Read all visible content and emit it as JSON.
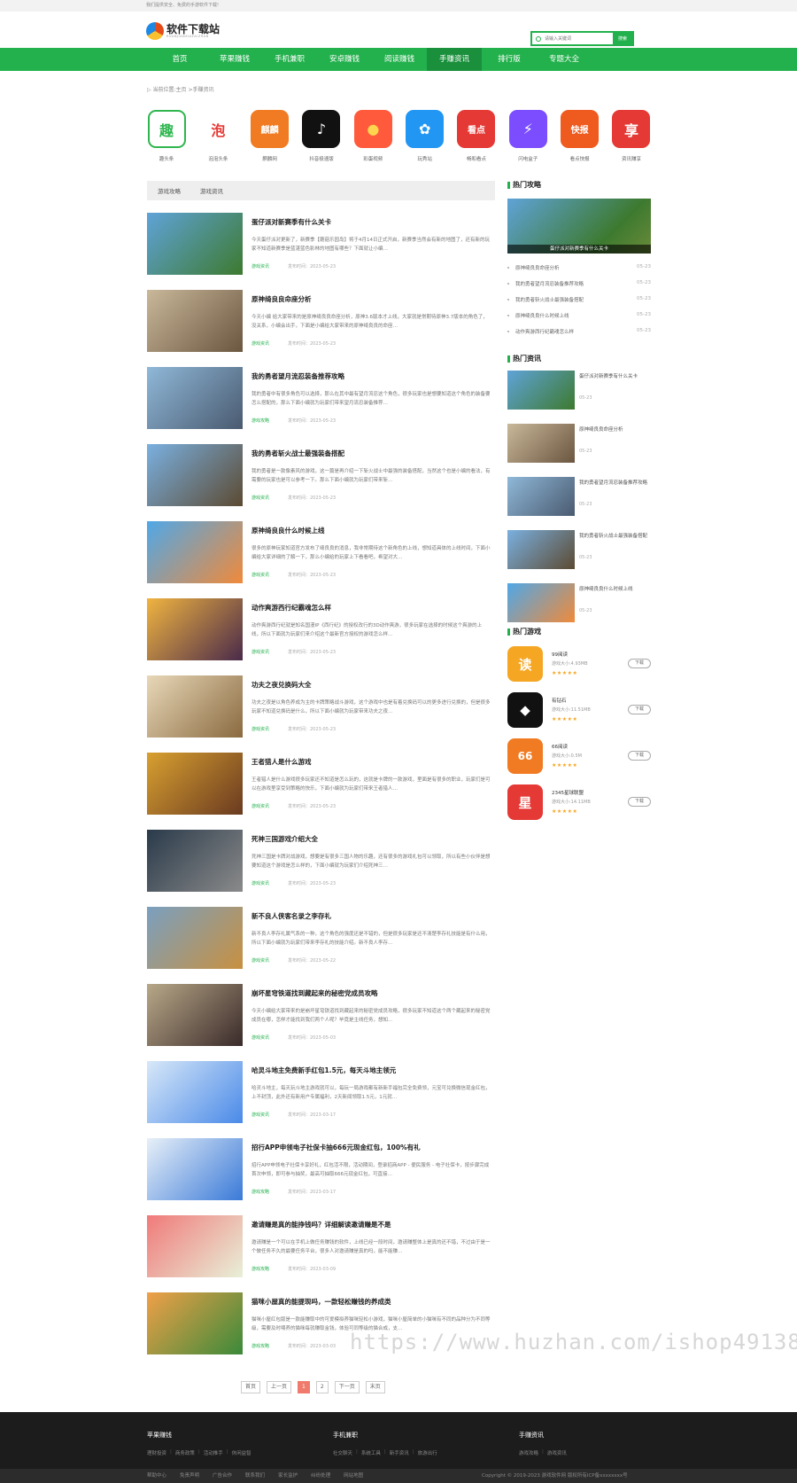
{
  "topbar": {
    "text": "我们提供安全、免费的手游软件下载!"
  },
  "logo": {
    "title": "软件下载站",
    "sub": "RUANJIANXIAZAIZHAN"
  },
  "search": {
    "placeholder": "请输入关键词",
    "button": "搜索"
  },
  "nav": [
    {
      "label": "首页",
      "active": false
    },
    {
      "label": "苹果赚钱",
      "active": false
    },
    {
      "label": "手机兼职",
      "active": false
    },
    {
      "label": "安卓赚钱",
      "active": false
    },
    {
      "label": "阅读赚钱",
      "active": false
    },
    {
      "label": "手赚资讯",
      "active": true
    },
    {
      "label": "排行版",
      "active": false
    },
    {
      "label": "专题大全",
      "active": false
    }
  ],
  "breadcrumb": "当前位置:主页 >手赚资讯",
  "apps": [
    {
      "name": "趣头条",
      "glyph": "趣",
      "color": "#2fb64f",
      "bg": "#fff",
      "border": "#2fb64f"
    },
    {
      "name": "泡泡头条",
      "glyph": "泡",
      "color": "#e53935",
      "bg": "#fff",
      "border": "#fff"
    },
    {
      "name": "麒麟网",
      "glyph": "麒麟",
      "color": "#fff",
      "bg": "#f07b22",
      "border": "#f07b22"
    },
    {
      "name": "抖音极速版",
      "glyph": "♪",
      "color": "#fff",
      "bg": "#111",
      "border": "#111"
    },
    {
      "name": "彩蛋视频",
      "glyph": "●",
      "color": "#ffd54f",
      "bg": "#ff5a3c",
      "border": "#ff5a3c"
    },
    {
      "name": "玩秀站",
      "glyph": "✿",
      "color": "#fff",
      "bg": "#2196f3",
      "border": "#2196f3"
    },
    {
      "name": "畅和看点",
      "glyph": "看点",
      "color": "#fff",
      "bg": "#e53935",
      "border": "#e53935"
    },
    {
      "name": "闪电盒子",
      "glyph": "⚡",
      "color": "#fff",
      "bg": "#7c4dff",
      "border": "#7c4dff"
    },
    {
      "name": "看点快报",
      "glyph": "快报",
      "color": "#fff",
      "bg": "#ef5a1e",
      "border": "#ef5a1e"
    },
    {
      "name": "资讯赚享",
      "glyph": "享",
      "color": "#fff",
      "bg": "#e53935",
      "border": "#e53935"
    }
  ],
  "tabs": [
    "游戏攻略",
    "游戏资讯"
  ],
  "articles": [
    {
      "title": "蛋仔派对新赛季有什么关卡",
      "desc": "今天蛋仔派对更新了，新赛季【蘑菇乐园岛】将于4月14日正式开启，新赛季当然会有新的地图了，还有新的玩家不知道新赛季是蓝湛蓝色影林的地图有哪些？下面就让小编…",
      "cat": "游戏资讯",
      "date": "发布时间：2023-05-23",
      "thumb": [
        "#5fa3d8",
        "#3d7a2f"
      ]
    },
    {
      "title": "原神绮良良命座分析",
      "desc": "今天小编 给大家带来的是原神绮良良命座分析，原神3.6版本才上线，大家就是常期待原神3.7版本的角色了，没关系，小编会出手，下面是小编给大家带来的原神绮良良的命座…",
      "cat": "游戏资讯",
      "date": "发布时间：2023-05-23",
      "thumb": [
        "#c9b89a",
        "#6b5640"
      ]
    },
    {
      "title": "我的勇者望月流忍装备推荐攻略",
      "desc": "我的勇者中有很多角色可以选择，那么在其中最有望月流忍这个角色，很多玩家也是想要知道这个角色的装备要怎么搭配的，那么下面小编就为玩家们带来望月流忍装备推荐…",
      "cat": "游戏攻略",
      "date": "发布时间：2023-05-23",
      "thumb": [
        "#8fb8d8",
        "#4a5a70"
      ]
    },
    {
      "title": "我的勇者斩火战士最强装备搭配",
      "desc": "我的勇者是一款像素风的游戏，这一篇是再介绍一下斩火战士中最强的装备搭配，当然这个也是小编的看法，有需要的玩家也是可以参考一下。那么下面小编就为玩家们带来斩…",
      "cat": "游戏资讯",
      "date": "发布时间：2023-05-23",
      "thumb": [
        "#7ab0e0",
        "#5c4a32"
      ]
    },
    {
      "title": "原神绮良良什么时候上线",
      "desc": "很多的原神玩家知道官方发布了绮良良的消息，我非常期待这个新角色的上线，想知道具体的上线时间，下面小编给大家详细的了解一下，那么小编给的玩家上下看看吧，希望对大…",
      "cat": "游戏资讯",
      "date": "发布时间：2023-05-23",
      "thumb": [
        "#4fa8e8",
        "#f08a3a"
      ]
    },
    {
      "title": "动作爽游西行纪霸魂怎么样",
      "desc": "动作爽游西行纪就是知名国漫IP《西行纪》的授权改行的3D动作爽游，很多玩家在选择的时候这个爽游的上线，所以下面就为玩家们来介绍这个最新官方授权的游戏怎么样…",
      "cat": "游戏资讯",
      "date": "发布时间：2023-05-23",
      "thumb": [
        "#f0b440",
        "#4a2a4a"
      ]
    },
    {
      "title": "功夫之夜兑换码大全",
      "desc": "功夫之夜是以角色养成为主的卡牌策略战斗游戏，这个游戏中也是有着兑换码可以的更多进行兑换的，但是很多玩家不知道兑换码是什么，所以下面小编就为玩家带来功夫之夜…",
      "cat": "游戏资讯",
      "date": "发布时间：2023-05-23",
      "thumb": [
        "#e8d8b8",
        "#8a6a40"
      ]
    },
    {
      "title": "王者猎人是什么游戏",
      "desc": "王者猎人是什么游戏很多玩家还不知道是怎么玩的，这就是卡牌的一款游戏，里面是有很多的职业，玩家们是可以在游戏里享受到策略的快乐，下面小编就为玩家们带来王者猎人…",
      "cat": "游戏资讯",
      "date": "发布时间：2023-05-23",
      "thumb": [
        "#d8a030",
        "#6a3a20"
      ]
    },
    {
      "title": "死神三国游戏介绍大全",
      "desc": "死神三国是卡牌对战游戏，想要是有很多三国人物的乐趣，还有很多的游戏礼包可以领取，所以有些小伙伴是想要知道这个游戏是怎么样的，下面小编就为玩家们介绍死神三…",
      "cat": "游戏资讯",
      "date": "发布时间：2023-05-23",
      "thumb": [
        "#2a3a4a",
        "#8a8a8a"
      ]
    },
    {
      "title": "新不良人侠客名录之李存礼",
      "desc": "新不良人李存礼属气系的一种，这个角色的强度还是不错的，但是很多玩家是还不清楚李存礼技能是有什么用，所以下面小编就为玩家们带来李存礼的技能介绍。新不良人李存…",
      "cat": "游戏资讯",
      "date": "发布时间：2023-05-22",
      "thumb": [
        "#7aa0c0",
        "#c89040"
      ]
    },
    {
      "title": "崩坏星穹铁道找到藏起来的秘密党成员攻略",
      "desc": "今天小编给大家带来的是崩坏星穹铁道找到藏起来的秘密党成员攻略，很多玩家不知道这个两个藏起来的秘密党成员在哪，怎样才能找到我们两个人呢？毕竟是主线任务，想知…",
      "cat": "游戏资讯",
      "date": "发布时间：2023-05-03",
      "thumb": [
        "#b8a888",
        "#3a2a2a"
      ]
    },
    {
      "title": "哈灵斗地主免费新手红包1.5元，每天斗地主领元",
      "desc": "哈灵斗地主，每天玩斗地主游戏就可以，每玩一局游戏都有新新手福包完全免费领，元宝可兑换微信现金红包，上不封顶，此外还有新用户专属福利，2天新闻领取1.5元，1元就…",
      "cat": "游戏资讯",
      "date": "发布时间：2023-03-17",
      "thumb": [
        "#d8e8f8",
        "#4a8ae8"
      ]
    },
    {
      "title": "招行APP申领电子社保卡抽666元现金红包，100%有礼",
      "desc": "招行APP申领电子社保卡享好礼，红包活不限，活动期间，登录招商APP - 便民服务 - 电子社保卡，按步骤完成首次申领，即可参与抽奖，最高可抽取666元现金红包，可直接…",
      "cat": "游戏攻略",
      "date": "发布时间：2023-03-17",
      "thumb": [
        "#e8f0f8",
        "#3a7ad8"
      ]
    },
    {
      "title": "邀请赚是真的能挣钱吗？详细解读邀请赚是不是",
      "desc": "邀请赚是一个可以在手机上做任务赚钱的软件，上线已经一段时间，邀请赚整体上是真的还不错，不过由于是一个做任务不久的最要任务平台，很多人对邀请赚是真的吗，能不能赚…",
      "cat": "游戏攻略",
      "date": "发布时间：2023-03-09",
      "thumb": [
        "#f07a7a",
        "#e8f0d8"
      ]
    },
    {
      "title": "猫咪小屋真的能提现吗，一款轻松赚钱的养成类",
      "desc": "猫咪小屋红包版是一款能赚取中的可爱模拟养猫咪轻松小游戏，猫咪小屋简单的小猫咪有不同的品种分为不同等级，需要及时喂养的猫咪每就赚取金钱，体验可同等级的猫合成，支…",
      "cat": "游戏攻略",
      "date": "发布时间：2023-03-03",
      "thumb": [
        "#f0a048",
        "#3a8a3a"
      ]
    }
  ],
  "pager": {
    "first": "首页",
    "prev": "上一页",
    "pages": [
      "1",
      "2"
    ],
    "next": "下一页",
    "last": "末页"
  },
  "side": {
    "hot_guides_title": "热门攻略",
    "banner_caption": "蛋仔派对新赛季有什么关卡",
    "hot_guides": [
      {
        "title": "原神绮良良命座分析",
        "date": "05-23"
      },
      {
        "title": "我的勇者望月流忍装备推荐攻略",
        "date": "05-23"
      },
      {
        "title": "我的勇者斩火战士最强装备搭配",
        "date": "05-23"
      },
      {
        "title": "原神绮良良什么时候上线",
        "date": "05-23"
      },
      {
        "title": "动作爽游西行纪霸魂怎么样",
        "date": "05-23"
      }
    ],
    "hot_news_title": "热门资讯",
    "hot_news": [
      {
        "title": "蛋仔派对新赛季有什么关卡",
        "date": "05-23",
        "thumb": [
          "#5fa3d8",
          "#3d7a2f"
        ]
      },
      {
        "title": "原神绮良良命座分析",
        "date": "05-23",
        "thumb": [
          "#c9b89a",
          "#6b5640"
        ]
      },
      {
        "title": "我的勇者望月流忍装备推荐攻略",
        "date": "05-23",
        "thumb": [
          "#8fb8d8",
          "#4a5a70"
        ]
      },
      {
        "title": "我的勇者斩火战士最强装备搭配",
        "date": "05-23",
        "thumb": [
          "#7ab0e0",
          "#5c4a32"
        ]
      },
      {
        "title": "原神绮良良什么时候上线",
        "date": "05-23",
        "thumb": [
          "#4fa8e8",
          "#f08a3a"
        ]
      }
    ],
    "hot_games_title": "热门游戏",
    "hot_games": [
      {
        "name": "99阅读",
        "size": "游戏大小:4.93MB",
        "glyph": "读",
        "bg": "#f5a623",
        "rating": 5
      },
      {
        "name": "有钻石",
        "size": "游戏大小:11.51MB",
        "glyph": "◆",
        "bg": "#111",
        "rating": 5
      },
      {
        "name": "66阅读",
        "size": "游戏大小:0.5M",
        "glyph": "66",
        "bg": "#f07b22",
        "rating": 5
      },
      {
        "name": "2345星球联盟",
        "size": "游戏大小:14.11MB",
        "glyph": "星",
        "bg": "#e53935",
        "rating": 5
      }
    ],
    "download_label": "下载"
  },
  "watermark": "https://www.huzhan.com/ishop49138",
  "footer": {
    "cols": [
      {
        "title": "苹果赚钱",
        "links": [
          "理财投资",
          "商务政策",
          "活动推手",
          "休闲益智"
        ]
      },
      {
        "title": "手机兼职",
        "links": [
          "社交聊天",
          "系统工具",
          "新手资讯",
          "旅游出行"
        ]
      },
      {
        "title": "手赚资讯",
        "links": [
          "游戏攻略",
          "游戏资讯"
        ]
      }
    ],
    "bottom_links": [
      "帮助中心",
      "免责声明",
      "广告合作",
      "联系我们",
      "家长监护",
      "纠纷处理",
      "网站地图"
    ],
    "copyright": "Copyright © 2019-2023 游戏软件网 版权所有ICP备xxxxxxxx号"
  }
}
